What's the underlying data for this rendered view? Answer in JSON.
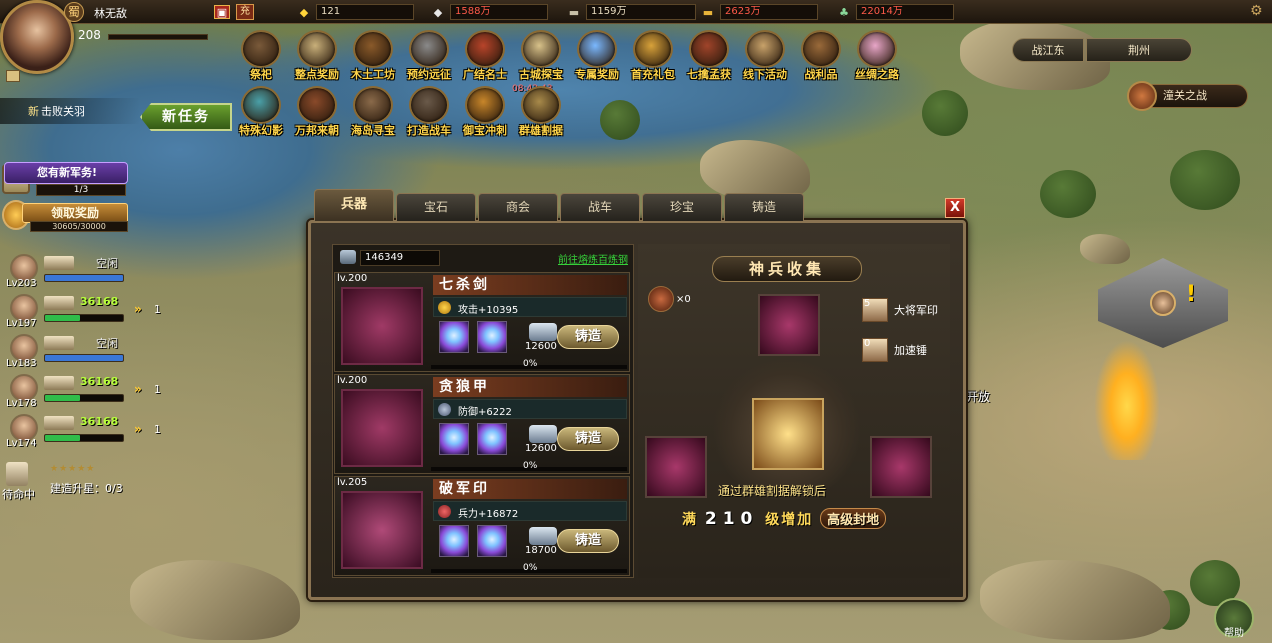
{
  "player": {
    "kingdom": "蜀",
    "name": "林无敌",
    "level": "208",
    "exp_fraction": 0.0
  },
  "top_resources": [
    {
      "icon": "gift-icon",
      "value": "充",
      "color": "#ffe0a0"
    },
    {
      "icon": "gold-ingot-icon",
      "value": "121",
      "color": "#e8dcc0"
    },
    {
      "icon": "silver-ingot-icon",
      "value": "1588万",
      "color": "#ff5a4a"
    },
    {
      "icon": "iron-bar-icon",
      "value": "1159万",
      "color": "#e8dcc0"
    },
    {
      "icon": "gold-bar-icon",
      "value": "2623万",
      "color": "#ff5a4a"
    },
    {
      "icon": "jade-icon",
      "value": "22014万",
      "color": "#ff5a4a"
    }
  ],
  "activity_icons_row1": [
    "祭祀",
    "整点奖励",
    "木土工坊",
    "预约远征",
    "广结名士",
    "古城探宝",
    "专属奖励",
    "首充礼包",
    "七擒孟获",
    "线下活动",
    "战利品",
    "丝绸之路"
  ],
  "activity_icons_row2": [
    "特殊幻影",
    "万邦来朝",
    "海岛寻宝",
    "打造战车",
    "御宝冲刺",
    "群雄割据"
  ],
  "activity_timer": "08:42:43",
  "nav": {
    "region": "战江东",
    "city": "荆州",
    "battle": "潼关之战"
  },
  "task": {
    "prefix": "新",
    "text": "击败关羽",
    "new_task_button": "新任务"
  },
  "army": {
    "alert": "您有新军务!",
    "count": "1/3",
    "claim": "领取奖励",
    "claim_progress": "30605/30000"
  },
  "heroes": [
    {
      "level": "Lv203",
      "status": "空闲",
      "bar_color": "#3a77d6",
      "bar_fill": 1.0,
      "arrow": "",
      "num": ""
    },
    {
      "level": "Lv197",
      "status": "36168",
      "bar_color": "#2fbd4a",
      "bar_fill": 0.45,
      "arrow": "»",
      "num": "1"
    },
    {
      "level": "Lv183",
      "status": "空闲",
      "bar_color": "#3a77d6",
      "bar_fill": 1.0,
      "arrow": "",
      "num": ""
    },
    {
      "level": "Lv178",
      "status": "36168",
      "bar_color": "#2fbd4a",
      "bar_fill": 0.45,
      "arrow": "»",
      "num": "1"
    },
    {
      "level": "Lv174",
      "status": "36168",
      "bar_color": "#2fbd4a",
      "bar_fill": 0.45,
      "arrow": "»",
      "num": "1"
    }
  ],
  "waiting": {
    "label": "待命中",
    "upgrade": "建造升星：0/3",
    "stars": "★★★★★",
    "rating": 1
  },
  "map": {
    "open_label": "开放",
    "help": "帮助"
  },
  "dialog": {
    "tabs": [
      "兵器",
      "宝石",
      "商会",
      "战车",
      "珍宝",
      "铸造"
    ],
    "active_tab": 0,
    "close": "X",
    "steel_value": "146349",
    "smelt_link": "前往熔炼百炼钢",
    "items": [
      {
        "lv": "lv.200",
        "name": "七杀剑",
        "stat": "攻击+10395",
        "stat_icon": "attack-icon",
        "cost": "12600",
        "button": "铸造",
        "pct": "0%"
      },
      {
        "lv": "lv.200",
        "name": "贪狼甲",
        "stat": "防御+6222",
        "stat_icon": "defense-icon",
        "cost": "12600",
        "button": "铸造",
        "pct": "0%"
      },
      {
        "lv": "lv.205",
        "name": "破军印",
        "stat": "兵力+16872",
        "stat_icon": "troops-icon",
        "cost": "18700",
        "button": "铸造",
        "pct": "0%"
      }
    ],
    "collection": {
      "title": "神兵收集",
      "hammer_count": "×0",
      "side": [
        {
          "num": "5",
          "label": "大将军印"
        },
        {
          "num": "0",
          "label": "加速锤"
        }
      ],
      "unlock_text": "通过群雄割据解锁后",
      "bottom_prefix": "满",
      "bottom_number": "210",
      "bottom_mid": "级增加",
      "bottom_pill": "高级封地"
    }
  }
}
